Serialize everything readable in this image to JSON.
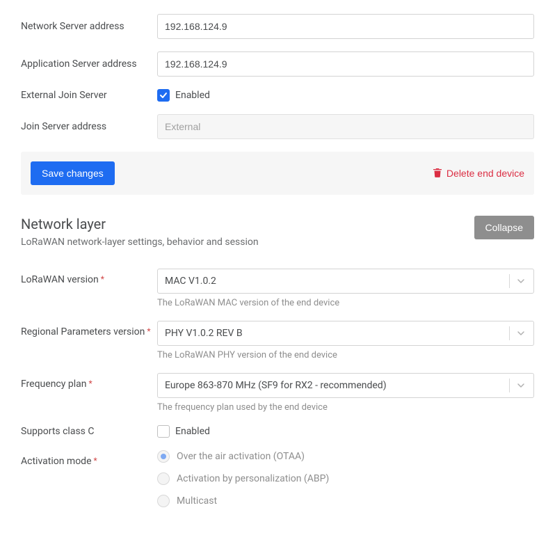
{
  "general": {
    "network_server_label": "Network Server address",
    "network_server_value": "192.168.124.9",
    "app_server_label": "Application Server address",
    "app_server_value": "192.168.124.9",
    "ext_join_label": "External Join Server",
    "ext_join_checkbox_label": "Enabled",
    "ext_join_checked": true,
    "join_server_label": "Join Server address",
    "join_server_placeholder": "External"
  },
  "actions": {
    "save_label": "Save changes",
    "delete_label": "Delete end device"
  },
  "network_layer": {
    "title": "Network layer",
    "description": "LoRaWAN network-layer settings, behavior and session",
    "collapse_label": "Collapse",
    "lorawan_version_label": "LoRaWAN version",
    "lorawan_version_value": "MAC V1.0.2",
    "lorawan_version_help": "The LoRaWAN MAC version of the end device",
    "regional_params_label": "Regional Parameters version",
    "regional_params_value": "PHY V1.0.2 REV B",
    "regional_params_help": "The LoRaWAN PHY version of the end device",
    "freq_plan_label": "Frequency plan",
    "freq_plan_value": "Europe 863-870 MHz (SF9 for RX2 - recommended)",
    "freq_plan_help": "The frequency plan used by the end device",
    "supports_class_c_label": "Supports class C",
    "supports_class_c_checkbox_label": "Enabled",
    "supports_class_c_checked": false,
    "activation_label": "Activation mode",
    "activation_options": [
      "Over the air activation (OTAA)",
      "Activation by personalization (ABP)",
      "Multicast"
    ],
    "activation_selected_index": 0
  }
}
